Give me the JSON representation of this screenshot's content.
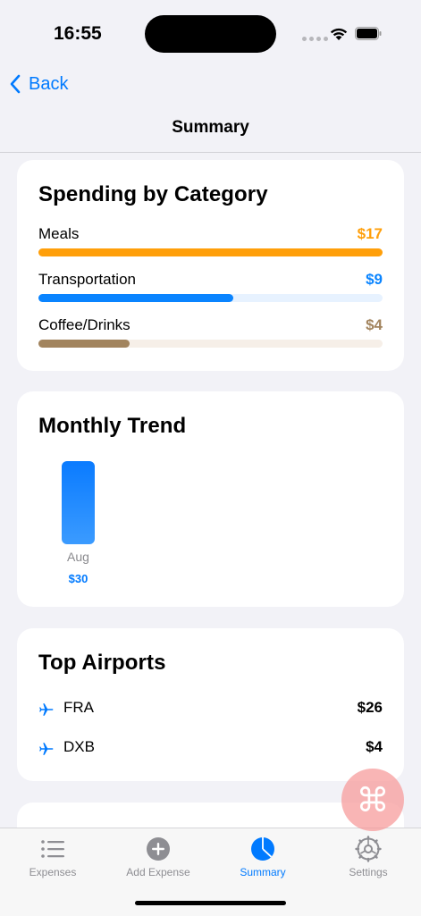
{
  "status_bar": {
    "time": "16:55"
  },
  "nav": {
    "back_label": "Back",
    "title": "Summary"
  },
  "spending_card": {
    "title": "Spending by Category",
    "categories": [
      {
        "name": "Meals",
        "amount": "$17",
        "fraction": 1.0,
        "color": "#ff9f0a",
        "track": "#fff2df"
      },
      {
        "name": "Transportation",
        "amount": "$9",
        "fraction": 0.565,
        "color": "#0a84ff",
        "track": "#e7f2ff"
      },
      {
        "name": "Coffee/Drinks",
        "amount": "$4",
        "fraction": 0.265,
        "color": "#a2845e",
        "track": "#f6efe8"
      }
    ]
  },
  "trend_card": {
    "title": "Monthly Trend",
    "bars": [
      {
        "month": "Aug",
        "value": "$30"
      }
    ]
  },
  "airports_card": {
    "title": "Top Airports",
    "airports": [
      {
        "code": "FRA",
        "amount": "$26"
      },
      {
        "code": "DXB",
        "amount": "$4"
      }
    ]
  },
  "fab": {
    "icon": "command-icon",
    "symbol": "⌘"
  },
  "tabs": [
    {
      "label": "Expenses",
      "icon": "list-icon"
    },
    {
      "label": "Add Expense",
      "icon": "plus-circle-icon"
    },
    {
      "label": "Summary",
      "icon": "chart-pie-icon"
    },
    {
      "label": "Settings",
      "icon": "gear-icon"
    }
  ],
  "colors": {
    "accent": "#007aff",
    "background": "#f2f2f7"
  }
}
